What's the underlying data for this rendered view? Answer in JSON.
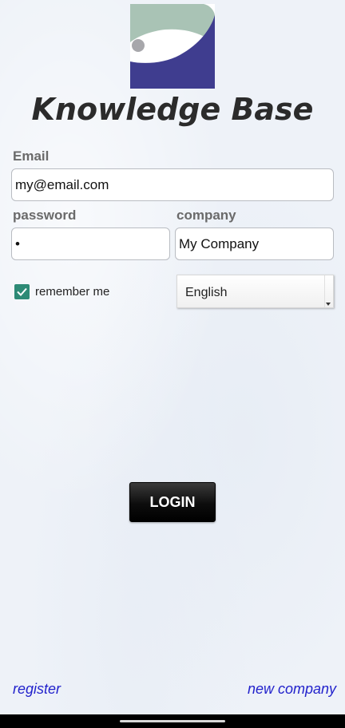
{
  "app": {
    "title": "Knowledge Base",
    "logo_icon": "knowledge-base-logo"
  },
  "form": {
    "email_label": "Email",
    "email_value": "my@email.com",
    "password_label": "password",
    "password_value": "•",
    "company_label": "company",
    "company_value": "My Company",
    "remember_label": "remember me",
    "remember_checked": true,
    "language_selected": "English",
    "login_label": "LOGIN"
  },
  "links": {
    "register": "register",
    "new_company": "new company"
  },
  "colors": {
    "checkbox": "#2d8a76",
    "link": "#2222cc",
    "logo_green": "#a9c3b5",
    "logo_blue": "#3f3d8f",
    "logo_gray": "#a7a7ab"
  }
}
